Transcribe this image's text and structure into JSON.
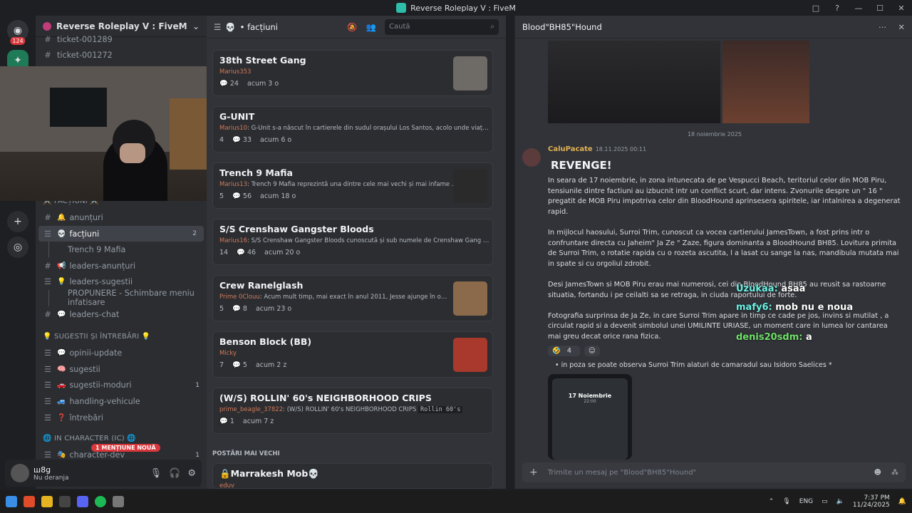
{
  "window": {
    "title": "Reverse Roleplay V : FiveM",
    "controls": [
      "□",
      "?",
      "—",
      "☐",
      "✕"
    ]
  },
  "servers": {
    "badge": "124"
  },
  "guild": {
    "name": "Reverse Roleplay V : FiveM",
    "chevron": "⌄"
  },
  "channels": {
    "top": [
      {
        "label": "ticket-001289",
        "count": ""
      },
      {
        "label": "ticket-001272",
        "count": ""
      }
    ],
    "cat_factions": "⚔️ FACȚIUNI ⚔️",
    "factions": [
      {
        "emoji": "🔔",
        "label": "anunțuri",
        "count": ""
      },
      {
        "emoji": "💀",
        "label": "facțiuni",
        "count": "2"
      },
      {
        "emoji": "",
        "label": "Trench 9 Mafia",
        "count": ""
      },
      {
        "emoji": "📢",
        "label": "leaders-anunțuri",
        "count": ""
      },
      {
        "emoji": "💡",
        "label": "leaders-sugestii",
        "count": ""
      },
      {
        "emoji": "",
        "label": "PROPUNERE - Schimbare meniu infatisare",
        "count": ""
      },
      {
        "emoji": "💬",
        "label": "leaders-chat",
        "count": ""
      }
    ],
    "cat_sugestii": "💡 SUGESTII ȘI ÎNTREBĂRI 💡",
    "sugestii": [
      {
        "emoji": "💬",
        "label": "opinii-update",
        "count": ""
      },
      {
        "emoji": "🧠",
        "label": "sugestii",
        "count": ""
      },
      {
        "emoji": "🚗",
        "label": "sugestii-moduri",
        "count": "1"
      },
      {
        "emoji": "🚙",
        "label": "handling-vehicule",
        "count": ""
      },
      {
        "emoji": "❓",
        "label": "întrebări",
        "count": ""
      }
    ],
    "cat_ic": "🌐 IN CHARACTER (IC) 🌐",
    "ic": [
      {
        "emoji": "🎭",
        "label": "character-dev",
        "count": "1"
      }
    ]
  },
  "mention_pill": "1 MENȚIUNE NOUĂ",
  "user": {
    "name": "ш8ց",
    "status": "Nu deranja"
  },
  "forum": {
    "icon": "💀",
    "title": "• facțiuni",
    "search_placeholder": "Caută",
    "posts": [
      {
        "title": "38th Street Gang",
        "author": "Marius353",
        "meta": "",
        "tag": "",
        "likes": "",
        "replies": "24",
        "time": "acum 3 o"
      },
      {
        "title": "G-UNIT",
        "author": "Marius10",
        "meta": "G-Unit s-a născut în cartierele din sudul orașului Los Santos, acolo unde viața nu i...",
        "tag": "",
        "likes": "4",
        "replies": "33",
        "time": "acum 6 o"
      },
      {
        "title": "Trench 9 Mafia",
        "author": "Marius13",
        "meta": "Trench 9 Mafia reprezintă una dintre cele mai vechi și mai infame ...",
        "tag": "",
        "likes": "5",
        "replies": "56",
        "time": "acum 18 o"
      },
      {
        "title": "S/S Crenshaw Gangster Bloods",
        "author": "Marius16",
        "meta": "S/S Crenshaw Gangster Bloods cunoscută și sub numele de Crenshaw Gang este ...",
        "tag": "",
        "likes": "14",
        "replies": "46",
        "time": "acum 20 o"
      },
      {
        "title": "Crew Ranelglash",
        "author": "Prime 0Clouu",
        "meta": "Acum mult timp, mai exact în anul 2011, Jesse ajunge în ora...",
        "tag": "",
        "likes": "5",
        "replies": "8",
        "time": "acum 23 o"
      },
      {
        "title": "Benson Block (BB)",
        "author": "Micky",
        "meta": "",
        "tag": "",
        "likes": "7",
        "replies": "5",
        "time": "acum 2 z"
      },
      {
        "title": "(W/S) ROLLIN' 60's NEIGHBORHOOD CRIPS",
        "author": "prime_beagle_37822",
        "meta": "(W/S) ROLLIN' 60's NEIGHBORHOOD CRIPS",
        "tag": "Rollin 60's",
        "likes": "",
        "replies": "1",
        "time": "acum 7 z"
      }
    ],
    "older_label": "POSTĂRI MAI VECHI",
    "older_post": {
      "title": "🔒Marrakesh Mob💀",
      "author": "eduv"
    }
  },
  "chat": {
    "title": "Blood\"BH85\"Hound",
    "date_separator": "18 noiembrie 2025",
    "message": {
      "author": "CaluPacate",
      "timestamp": "18.11.2025 00:11",
      "heading": "REVENGE!",
      "paragraphs": [
        "In seara de 17 noiembrie, in zona intunecata de pe Vespucci Beach, teritoriul celor din MOB Piru, tensiunile dintre factiuni au izbucnit intr un conflict scurt, dar intens. Zvonurile despre un \" 16 \" pregatit de MOB Piru impotriva celor din BloodHound aprinsesera spiritele, iar intalnirea a degenerat rapid.",
        "In mijlocul haosului, Surroi Trim, cunoscut ca vocea cartierului JamesTown, a fost prins intr o confruntare directa cu Jaheim\" Ja Ze \" Zaze, figura dominanta a BloodHound BH85. Lovitura primita de Surroi Trim, o rotatie rapida cu o rozeta ascutita, l a lasat cu sange la nas, mandibula mutata mai in spate si cu orgoliul zdrobit.",
        "Desi JamesTown si MOB Piru erau mai numerosi, cei din BloodHound BH85 au reusit sa rastoarne situatia, fortandu i pe ceilalti sa se retraga, in ciuda raportului de forte.",
        "Fotografia surprinsa de Ja Ze, in care Surroi Trim apare in timp ce cade pe jos, invins si mutilat , a circulat rapid si a devenit simbolul unei UMILINTE URIASE, un moment care in lumea lor cantarea mai greu decat orice rana fizica."
      ],
      "reaction_count": "4",
      "bullet": "in poza se poate observa Surroi Trim alaturi de camaradul sau Isidoro Saelices *",
      "phone_date": "17 Noiembrie",
      "phone_time": "22:00"
    },
    "composer_placeholder": "Trimite un mesaj pe \"Blood\"BH85\"Hound\""
  },
  "stream_overlay": [
    {
      "name": "Uzukaa:",
      "text": "asaa"
    },
    {
      "name": "mafy6:",
      "text": "mob nu e noua"
    },
    {
      "name": "denis20sdm:",
      "text": "a"
    }
  ],
  "taskbar": {
    "lang": "ENG",
    "time": "7:37 PM",
    "date": "11/24/2025"
  },
  "colors": {
    "accent": "#2dbda8",
    "mention": "#da373c",
    "username": "#e1b152"
  }
}
